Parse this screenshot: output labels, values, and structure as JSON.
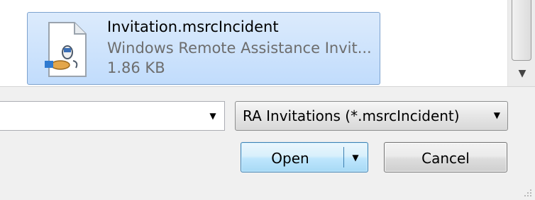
{
  "selected_file": {
    "name": "Invitation.msrcIncident",
    "type": "Windows Remote Assistance Invit...",
    "size": "1.86 KB",
    "icon": "remote-assistance-invitation-file-icon"
  },
  "filename_field": {
    "value": ""
  },
  "file_type_filter": {
    "selected": "RA Invitations (*.msrcIncident)"
  },
  "buttons": {
    "open": "Open",
    "cancel": "Cancel"
  },
  "colors": {
    "selection_fill": "#c1dcfc",
    "selection_border": "#7da2ce",
    "default_button_border": "#3c7fb1",
    "panel_background": "#f0f0f0"
  }
}
